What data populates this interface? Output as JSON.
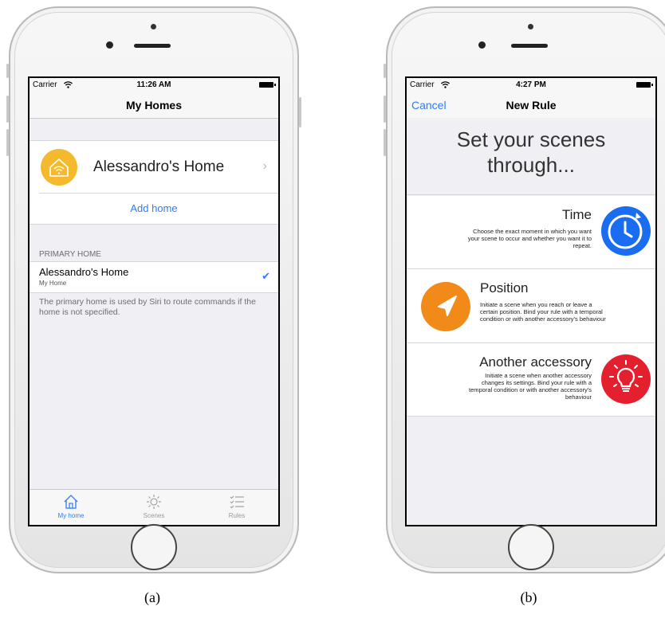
{
  "panel_a": {
    "status": {
      "carrier": "Carrier",
      "time": "11:26 AM"
    },
    "nav_title": "My Homes",
    "home_name": "Alessandro's Home",
    "add_home": "Add home",
    "section_header": "PRIMARY HOME",
    "primary": {
      "name": "Alessandro's Home",
      "subtitle": "My Home"
    },
    "footnote": "The primary home is used by Siri to route commands if the home is not specified.",
    "tabs": [
      "My home",
      "Scenes",
      "Rules"
    ],
    "caption": "(a)"
  },
  "panel_b": {
    "status": {
      "carrier": "Carrier",
      "time": "4:27 PM"
    },
    "cancel": "Cancel",
    "nav_title": "New Rule",
    "hero_line1": "Set your scenes",
    "hero_line2": "through...",
    "rules": [
      {
        "title": "Time",
        "desc1": "Choose the exact moment in which you want",
        "desc2": "your scene to occur and whether you want it to",
        "desc3": "repeat.",
        "icon": "clock-icon",
        "color": "#1a6cf0"
      },
      {
        "title": "Position",
        "desc1": "Initiate a scene when you reach or leave a",
        "desc2": "certain position. Bind your rule with a temporal",
        "desc3": "condition or with another accessory's behaviour",
        "icon": "location-arrow-icon",
        "color": "#f28a1a"
      },
      {
        "title": "Another accessory",
        "desc1": "Initiate a scene when another accessory",
        "desc2": "changes its settings. Bind your rule with a",
        "desc3": "temporal condition or with another accessory's",
        "desc4": "behaviour",
        "icon": "lightbulb-icon",
        "color": "#e5202e"
      }
    ],
    "caption": "(b)"
  },
  "colors": {
    "accent": "#2f7cf6",
    "home_icon": "#f5b92e"
  }
}
